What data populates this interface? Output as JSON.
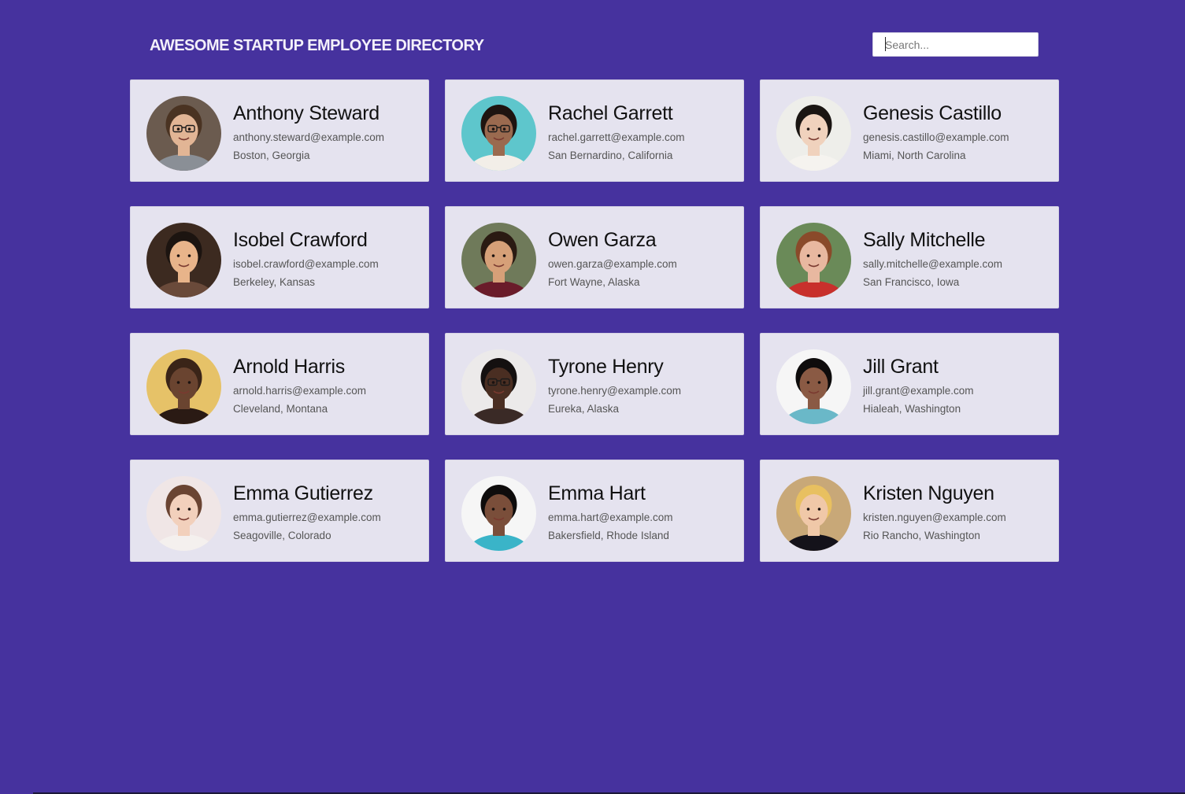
{
  "header": {
    "title": "AWESOME STARTUP EMPLOYEE DIRECTORY"
  },
  "search": {
    "placeholder": "Search...",
    "value": ""
  },
  "colors": {
    "background": "#46329e",
    "card": "#e5e3ef",
    "title": "#f3f0fa"
  },
  "employees": [
    {
      "name": "Anthony Steward",
      "email": "anthony.steward@example.com",
      "location": "Boston, Georgia",
      "avatar": {
        "bg": "#6b5b4f",
        "skin": "#e2b595",
        "hair": "#4a3322",
        "shirt": "#8a8f96",
        "glasses": true
      }
    },
    {
      "name": "Rachel Garrett",
      "email": "rachel.garrett@example.com",
      "location": "San Bernardino, California",
      "avatar": {
        "bg": "#5ec6cc",
        "skin": "#9a6a4f",
        "hair": "#1e1410",
        "shirt": "#f2eee8",
        "glasses": true
      }
    },
    {
      "name": "Genesis Castillo",
      "email": "genesis.castillo@example.com",
      "location": "Miami, North Carolina",
      "avatar": {
        "bg": "#eeeeea",
        "skin": "#f0d2bd",
        "hair": "#1a1512",
        "shirt": "#f5f3ef",
        "glasses": false
      }
    },
    {
      "name": "Isobel Crawford",
      "email": "isobel.crawford@example.com",
      "location": "Berkeley, Kansas",
      "avatar": {
        "bg": "#3c2a20",
        "skin": "#e8b48a",
        "hair": "#1c1410",
        "shirt": "#6a4a3a",
        "glasses": false
      }
    },
    {
      "name": "Owen Garza",
      "email": "owen.garza@example.com",
      "location": "Fort Wayne, Alaska",
      "avatar": {
        "bg": "#6f7a5a",
        "skin": "#d6a078",
        "hair": "#2a1a12",
        "shirt": "#6a1c2a",
        "glasses": false
      }
    },
    {
      "name": "Sally Mitchelle",
      "email": "sally.mitchelle@example.com",
      "location": "San Francisco, Iowa",
      "avatar": {
        "bg": "#6a8a58",
        "skin": "#e8b8a0",
        "hair": "#8a4a2a",
        "shirt": "#c8302c",
        "glasses": false
      }
    },
    {
      "name": "Arnold Harris",
      "email": "arnold.harris@example.com",
      "location": "Cleveland, Montana",
      "avatar": {
        "bg": "#e6c268",
        "skin": "#6a4430",
        "hair": "#3a2418",
        "shirt": "#2a1a14",
        "glasses": false
      }
    },
    {
      "name": "Tyrone Henry",
      "email": "tyrone.henry@example.com",
      "location": "Eureka, Alaska",
      "avatar": {
        "bg": "#eceaea",
        "skin": "#4a2e22",
        "hair": "#141010",
        "shirt": "#3a2a26",
        "glasses": true
      }
    },
    {
      "name": "Jill Grant",
      "email": "jill.grant@example.com",
      "location": "Hialeah, Washington",
      "avatar": {
        "bg": "#f6f6f6",
        "skin": "#8a5a44",
        "hair": "#0e0c0c",
        "shirt": "#6ab8c8",
        "glasses": false
      }
    },
    {
      "name": "Emma Gutierrez",
      "email": "emma.gutierrez@example.com",
      "location": "Seagoville, Colorado",
      "avatar": {
        "bg": "#f0e6e6",
        "skin": "#f2d0bc",
        "hair": "#6a4432",
        "shirt": "#f4f0ee",
        "glasses": false
      }
    },
    {
      "name": "Emma Hart",
      "email": "emma.hart@example.com",
      "location": "Bakersfield, Rhode Island",
      "avatar": {
        "bg": "#f6f6f6",
        "skin": "#7a4e3a",
        "hair": "#0e0c0c",
        "shirt": "#3ab4c8",
        "glasses": false
      }
    },
    {
      "name": "Kristen Nguyen",
      "email": "kristen.nguyen@example.com",
      "location": "Rio Rancho, Washington",
      "avatar": {
        "bg": "#c8a878",
        "skin": "#f0c8a8",
        "hair": "#e8c060",
        "shirt": "#14121a",
        "glasses": false
      }
    }
  ]
}
